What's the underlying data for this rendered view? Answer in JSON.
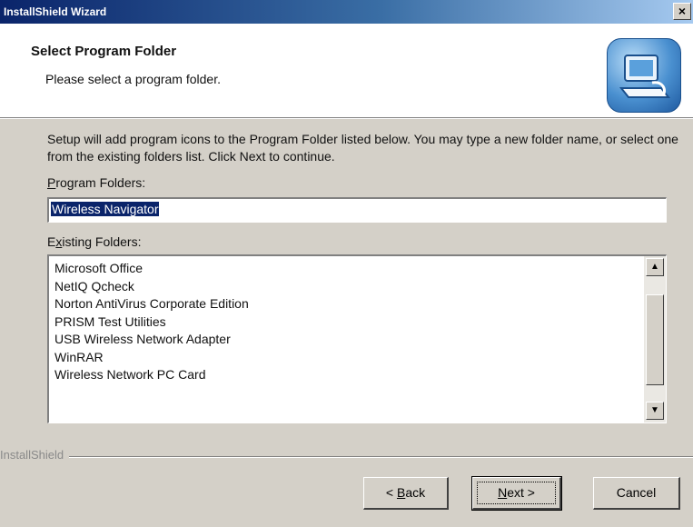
{
  "window": {
    "title": "InstallShield Wizard",
    "close_glyph": "×"
  },
  "header": {
    "title": "Select Program Folder",
    "subtitle": "Please select a program folder.",
    "icon": "computer-installer-icon"
  },
  "intro_text": "Setup will add program icons to the Program Folder listed below.  You may type a new folder name, or select one from the existing folders list.  Click Next to continue.",
  "program_folder": {
    "label_accel": "P",
    "label_rest": "rogram Folders:",
    "value": "Wireless Navigator"
  },
  "existing_folders": {
    "label_pre": "E",
    "label_accel": "x",
    "label_rest": "isting Folders:",
    "items": [
      "Microsoft Office",
      "NetIQ Qcheck",
      "Norton AntiVirus Corporate Edition",
      "PRISM Test Utilities",
      "USB Wireless Network Adapter",
      "WinRAR",
      "Wireless Network PC Card"
    ],
    "scroll_up_glyph": "▲",
    "scroll_down_glyph": "▼"
  },
  "brand": "InstallShield",
  "buttons": {
    "back_pre": "< ",
    "back_accel": "B",
    "back_rest": "ack",
    "next_accel": "N",
    "next_rest": "ext >",
    "cancel": "Cancel"
  },
  "colors": {
    "title_bar": "#0a246a",
    "dialog_face": "#d4d0c8",
    "selection": "#0a246a"
  }
}
